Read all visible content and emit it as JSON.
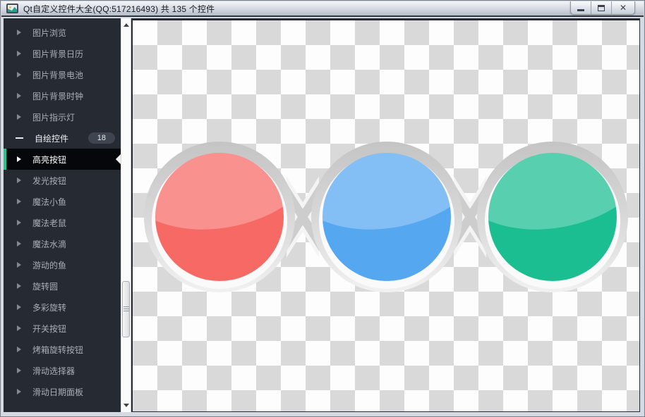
{
  "window": {
    "title": "Qt自定义控件大全(QQ:517216493) 共 135 个控件",
    "controls": {
      "close": "✕"
    }
  },
  "sidebar": {
    "items": [
      {
        "label": "图片浏览"
      },
      {
        "label": "图片背景日历"
      },
      {
        "label": "图片背景电池"
      },
      {
        "label": "图片背景时钟"
      },
      {
        "label": "图片指示灯"
      },
      {
        "label": "自绘控件",
        "badge": "18",
        "expanded": true
      },
      {
        "label": "高亮按钮",
        "selected": true
      },
      {
        "label": "发光按钮"
      },
      {
        "label": "魔法小鱼"
      },
      {
        "label": "魔法老鼠"
      },
      {
        "label": "魔法水滴"
      },
      {
        "label": "游动的鱼"
      },
      {
        "label": "旋转圆"
      },
      {
        "label": "多彩旋转"
      },
      {
        "label": "开关按钮"
      },
      {
        "label": "烤箱旋转按钮"
      },
      {
        "label": "滑动选择器"
      },
      {
        "label": "滑动日期面板"
      }
    ]
  },
  "main": {
    "buttons": [
      {
        "name": "red-highlight-button",
        "color": "#f76964",
        "highlight": "#fa938e"
      },
      {
        "name": "blue-highlight-button",
        "color": "#55a7f0",
        "highlight": "#8ac2f7"
      },
      {
        "name": "green-highlight-button",
        "color": "#1bbe90",
        "highlight": "#54ccaa"
      }
    ],
    "colors": {
      "checker_light": "#fdfdfd",
      "checker_dark": "#d9d9d9",
      "ring": "#cccccc",
      "selection_accent": "#1ec895",
      "sidebar_bg": "#262a33"
    }
  }
}
